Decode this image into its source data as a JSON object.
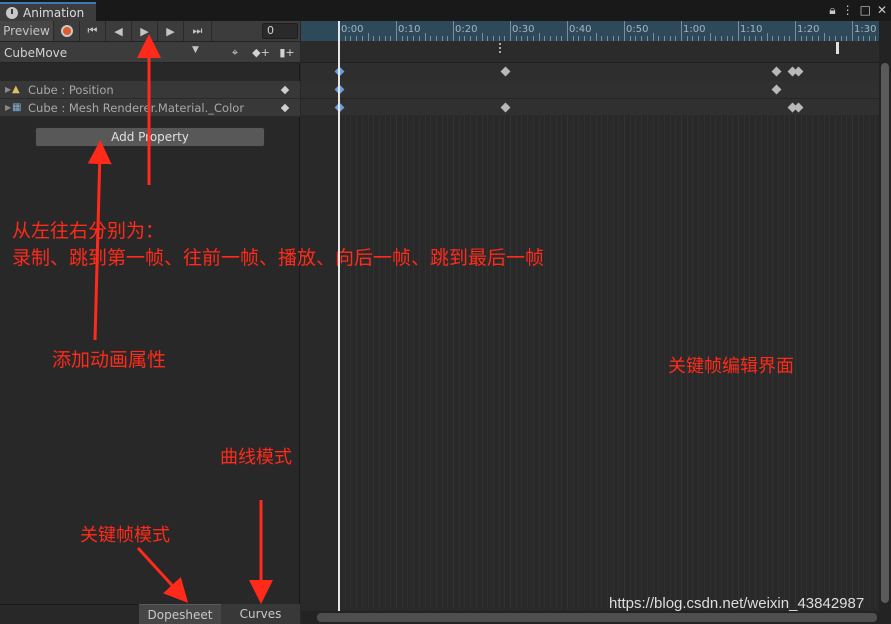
{
  "window": {
    "tab_title": "Animation",
    "icons": [
      "lock-icon",
      "menu-icon",
      "maximize-icon",
      "close-icon"
    ]
  },
  "toolbar": {
    "preview_label": "Preview",
    "frame_value": "0",
    "clip_name": "CubeMove"
  },
  "properties": [
    {
      "label": "Cube : Position",
      "icon": "transform-icon"
    },
    {
      "label": "Cube : Mesh Renderer.Material._Color",
      "icon": "mesh-renderer-icon"
    }
  ],
  "add_property_label": "Add Property",
  "bottom_tabs": {
    "dopesheet": "Dopesheet",
    "curves": "Curves"
  },
  "timeline": {
    "ticks": [
      "0:00",
      "0:10",
      "0:20",
      "0:30",
      "0:40",
      "0:50",
      "1:00",
      "1:10",
      "1:20",
      "1:30"
    ],
    "keyframes_summary": [
      0,
      0.3,
      0.79,
      0.82,
      0.83
    ],
    "keyframes_position": [
      0,
      0.79
    ],
    "keyframes_color": [
      0,
      0.3,
      0.82,
      0.83
    ]
  },
  "annotations": {
    "controls_title": "从左往右分别为：",
    "controls_desc": "录制、跳到第一帧、往前一帧、播放、向后一帧、跳到最后一帧",
    "add_property": "添加动画属性",
    "keyframe_editor": "关键帧编辑界面",
    "curves_mode": "曲线模式",
    "dopesheet_mode": "关键帧模式"
  },
  "watermark": "https://blog.csdn.net/weixin_43842987",
  "colors": {
    "accent_record": "#e05a2c",
    "annotation": "#ff2a1a",
    "ruler": "#2e4a5a",
    "selected_key": "#6a9fe0"
  }
}
